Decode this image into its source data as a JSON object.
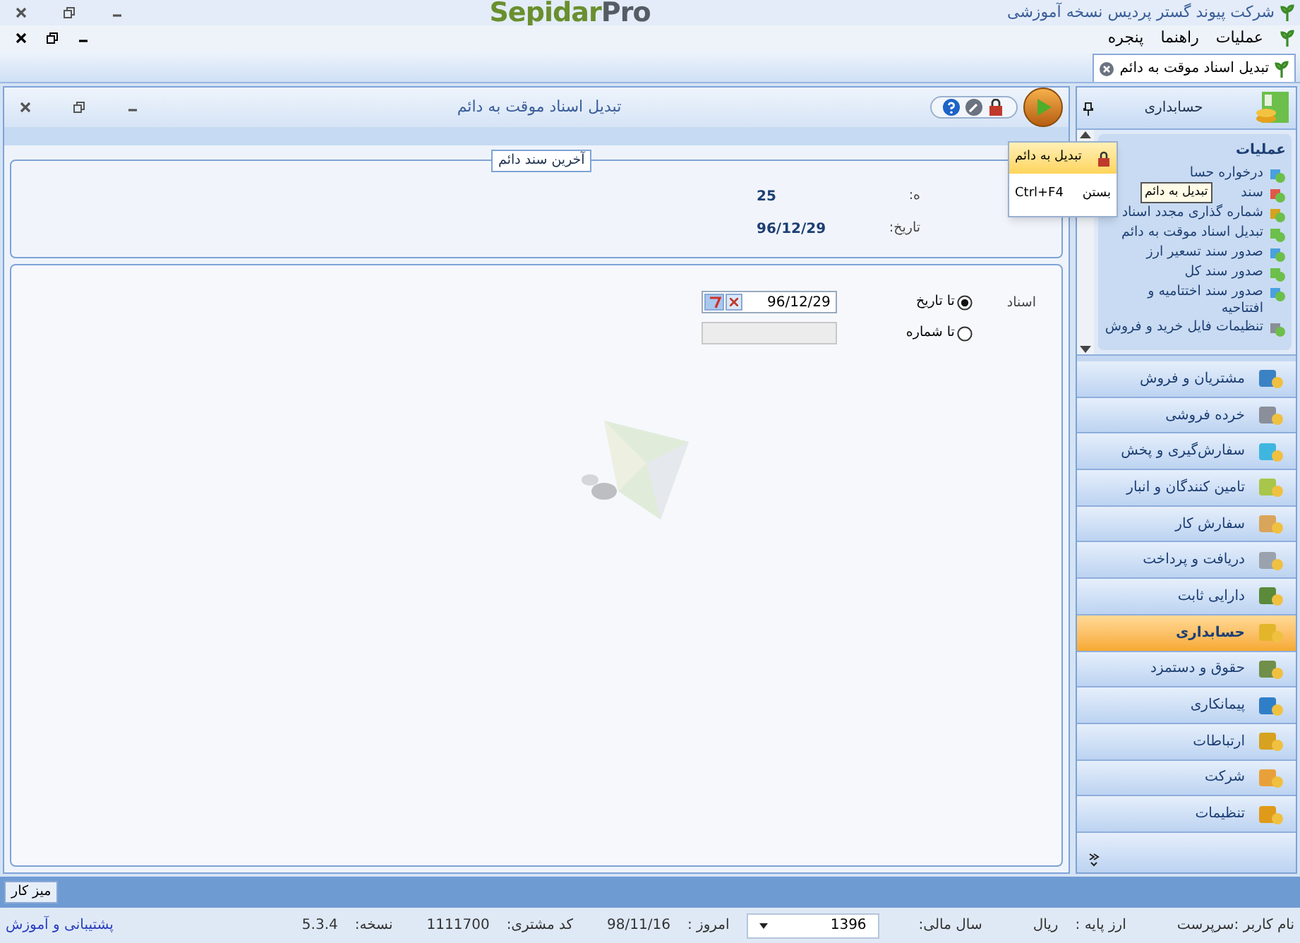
{
  "app_title": "شرکت پیوند گستر پردیس نسخه آموزشی",
  "logo": {
    "main": "Sepidar",
    "accent": "Pro"
  },
  "menu": [
    {
      "label": "عملیات"
    },
    {
      "label": "راهنما"
    },
    {
      "label": "پنجره"
    }
  ],
  "doc_tabs": [
    {
      "label": "تبدیل اسناد موقت به دائم",
      "selected": true
    }
  ],
  "window": {
    "title": "تبدیل اسناد موقت به دائم",
    "last_doc": {
      "legend": "آخرین سند دائم",
      "fields": [
        {
          "label": "ه:",
          "value": "25"
        },
        {
          "label": "تاریخ:",
          "value": "96/12/29"
        }
      ]
    },
    "filter": {
      "label": "اسناد",
      "options": [
        {
          "label": "تا تاریخ",
          "selected": true,
          "value": "96/12/29"
        },
        {
          "label": "تا شماره",
          "selected": false
        }
      ]
    }
  },
  "orb_menu": {
    "items": [
      {
        "label": "تبدیل به دائم",
        "highlighted": true
      },
      {
        "label": "بستن",
        "shortcut": "Ctrl+F4",
        "highlighted": false
      }
    ],
    "tooltip": "تبدیل به دائم"
  },
  "side_panel": {
    "title": "حسابداری",
    "tasks_title": "عملیات",
    "tasks": [
      {
        "label": "درخواره حسا"
      },
      {
        "label": "سند"
      },
      {
        "label": "شماره گذاری مجدد اسناد"
      },
      {
        "label": "تبدیل اسناد موقت به دائم"
      },
      {
        "label": "صدور سند تسعیر ارز"
      },
      {
        "label": "صدور سند کل"
      },
      {
        "label": "صدور سند اختتامیه و افتتاحیه"
      },
      {
        "label": "تنظیمات فایل خرید و فروش"
      }
    ],
    "modules": [
      {
        "label": "مشتریان و فروش",
        "selected": false,
        "color": "#3b82c4"
      },
      {
        "label": "خرده فروشی",
        "selected": false,
        "color": "#8a8f99"
      },
      {
        "label": "سفارش‌گیری و پخش",
        "selected": false,
        "color": "#3fb6e0"
      },
      {
        "label": "تامین کنندگان و انبار",
        "selected": false,
        "color": "#a8c64a"
      },
      {
        "label": "سفارش کار",
        "selected": false,
        "color": "#d9a55a"
      },
      {
        "label": "دریافت و پرداخت",
        "selected": false,
        "color": "#9aa3ad"
      },
      {
        "label": "دارایی ثابت",
        "selected": false,
        "color": "#5a8a3a"
      },
      {
        "label": "حسابداری",
        "selected": true,
        "color": "#e3b52b"
      },
      {
        "label": "حقوق و دستمزد",
        "selected": false,
        "color": "#6f8f4a"
      },
      {
        "label": "پیمانکاری",
        "selected": false,
        "color": "#2f7fc8"
      },
      {
        "label": "ارتباطات",
        "selected": false,
        "color": "#d6a21f"
      },
      {
        "label": "شرکت",
        "selected": false,
        "color": "#e8a13a"
      },
      {
        "label": "تنظیمات",
        "selected": false,
        "color": "#e09a1a"
      }
    ]
  },
  "taskbar": {
    "button": "میز کار"
  },
  "status_bar": {
    "user": "نام کاربر :سرپرست",
    "currency_label": "ارز پایه :",
    "currency": "ريال",
    "year_label": "سال مالی:",
    "year": "1396",
    "today_label": "امروز :",
    "today": "98/11/16",
    "customer_label": "کد مشتری:",
    "customer": "1111700",
    "version_label": "نسخه:",
    "version": "5.3.4",
    "support_link": "پشتیبانی و آموزش"
  }
}
